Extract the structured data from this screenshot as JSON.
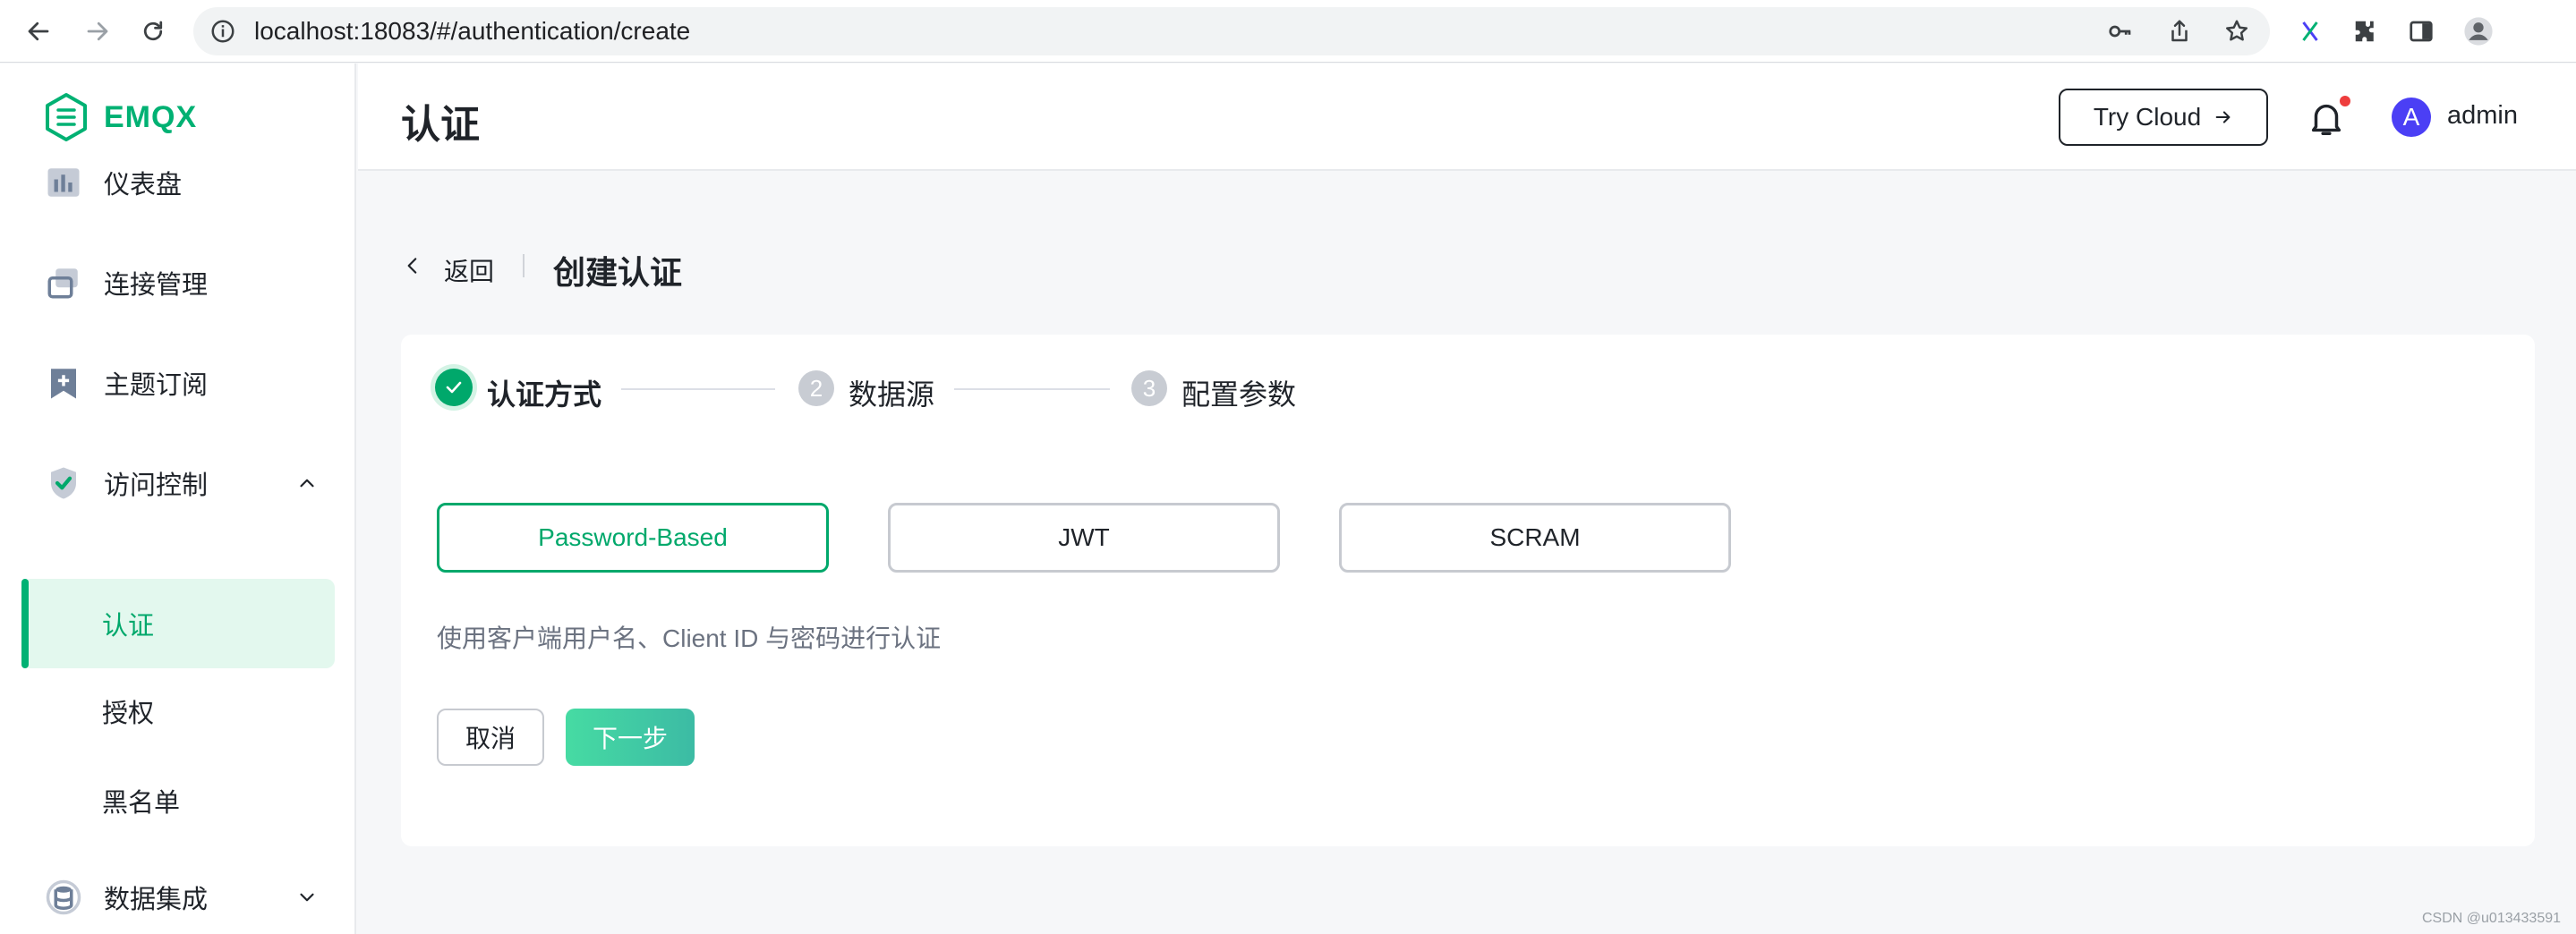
{
  "browser": {
    "url": "localhost:18083/#/authentication/create"
  },
  "app": {
    "logo_text": "EMQX",
    "brand_color": "#00b173"
  },
  "sidebar": {
    "items": [
      {
        "label": "仪表盘",
        "icon": "dashboard-icon"
      },
      {
        "label": "连接管理",
        "icon": "connections-icon"
      },
      {
        "label": "主题订阅",
        "icon": "subscription-icon"
      },
      {
        "label": "访问控制",
        "icon": "shield-icon",
        "expanded": true
      },
      {
        "label": "数据集成",
        "icon": "data-integration-icon",
        "expanded": false
      }
    ],
    "sub_items": [
      {
        "label": "认证",
        "active": true
      },
      {
        "label": "授权",
        "active": false
      },
      {
        "label": "黑名单",
        "active": false
      }
    ]
  },
  "header": {
    "title": "认证",
    "try_cloud_label": "Try Cloud",
    "avatar_letter": "A",
    "username": "admin"
  },
  "breadcrumb": {
    "back_label": "返回",
    "title": "创建认证"
  },
  "steps": [
    {
      "label": "认证方式",
      "number": "1",
      "status": "done"
    },
    {
      "label": "数据源",
      "number": "2",
      "status": "todo"
    },
    {
      "label": "配置参数",
      "number": "3",
      "status": "todo"
    }
  ],
  "methods": [
    {
      "label": "Password-Based",
      "selected": true
    },
    {
      "label": "JWT",
      "selected": false
    },
    {
      "label": "SCRAM",
      "selected": false
    }
  ],
  "description": "使用客户端用户名、Client ID 与密码进行认证",
  "actions": {
    "cancel_label": "取消",
    "next_label": "下一步"
  },
  "watermark": "CSDN @u013433591"
}
